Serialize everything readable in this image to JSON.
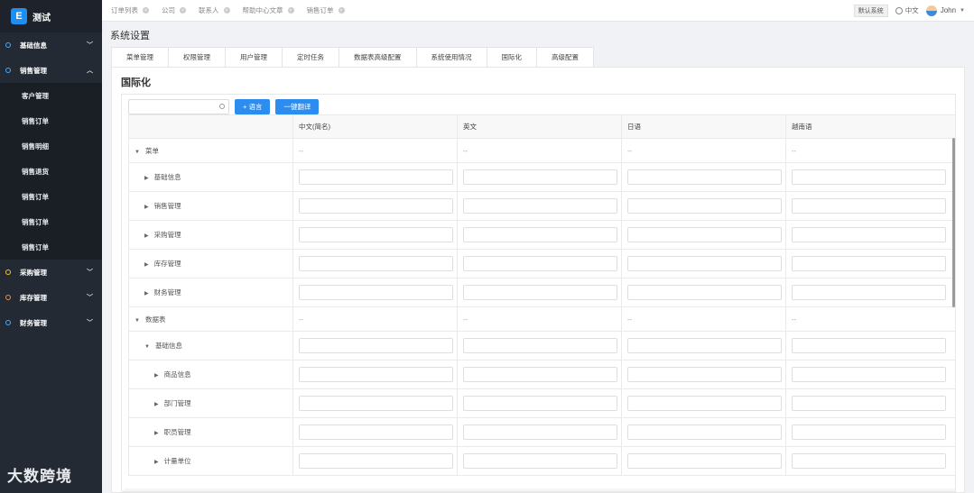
{
  "brand": {
    "logo": "E",
    "name": "测试"
  },
  "sidebar": {
    "items": [
      {
        "type": "group",
        "label": "基础信息",
        "dot": "#4aa8ff",
        "expanded": false
      },
      {
        "type": "group",
        "label": "销售管理",
        "dot": "#4aa8ff",
        "expanded": true
      },
      {
        "type": "item",
        "label": "客户管理"
      },
      {
        "type": "item",
        "label": "销售订单"
      },
      {
        "type": "item",
        "label": "销售明细"
      },
      {
        "type": "item",
        "label": "销售退货"
      },
      {
        "type": "item",
        "label": "销售订单"
      },
      {
        "type": "item",
        "label": "销售订单"
      },
      {
        "type": "item",
        "label": "销售订单"
      },
      {
        "type": "group",
        "label": "采购管理",
        "dot": "#f5c542",
        "expanded": false
      },
      {
        "type": "group",
        "label": "库存管理",
        "dot": "#f08a4b",
        "expanded": false
      },
      {
        "type": "group",
        "label": "财务管理",
        "dot": "#4aa8ff",
        "expanded": false
      }
    ],
    "watermark": "大数跨境"
  },
  "topbar": {
    "tabs": [
      "订单列表",
      "公司",
      "联系人",
      "帮助中心文章",
      "销售订单"
    ],
    "system": "默认系统",
    "lang": "中文",
    "user": "John"
  },
  "page": {
    "title": "系统设置",
    "tabs": [
      "菜单管理",
      "权限管理",
      "用户管理",
      "定时任务",
      "数据表高级配置",
      "系统使用情况",
      "国际化",
      "高级配置"
    ],
    "active_tab": "国际化",
    "panel_title": "国际化"
  },
  "toolbar": {
    "add_label": "+ 语言",
    "translate_label": "一键翻译"
  },
  "table": {
    "columns": [
      "",
      "中文(简名)",
      "英文",
      "日语",
      "越南语"
    ],
    "rows": [
      {
        "label": "菜单",
        "indent": 0,
        "expanded": true,
        "kind": "dash"
      },
      {
        "label": "基础信息",
        "indent": 1,
        "expanded": false,
        "kind": "input"
      },
      {
        "label": "销售管理",
        "indent": 1,
        "expanded": false,
        "kind": "input"
      },
      {
        "label": "采购管理",
        "indent": 1,
        "expanded": false,
        "kind": "input"
      },
      {
        "label": "库存管理",
        "indent": 1,
        "expanded": false,
        "kind": "input"
      },
      {
        "label": "财务管理",
        "indent": 1,
        "expanded": false,
        "kind": "input"
      },
      {
        "label": "数据表",
        "indent": 0,
        "expanded": true,
        "kind": "dash"
      },
      {
        "label": "基础信息",
        "indent": 1,
        "expanded": true,
        "kind": "input"
      },
      {
        "label": "商品信息",
        "indent": 2,
        "expanded": false,
        "kind": "input"
      },
      {
        "label": "部门管理",
        "indent": 2,
        "expanded": false,
        "kind": "input"
      },
      {
        "label": "职员管理",
        "indent": 2,
        "expanded": false,
        "kind": "input"
      },
      {
        "label": "计量单位",
        "indent": 2,
        "expanded": false,
        "kind": "input"
      }
    ],
    "dash": "--"
  }
}
